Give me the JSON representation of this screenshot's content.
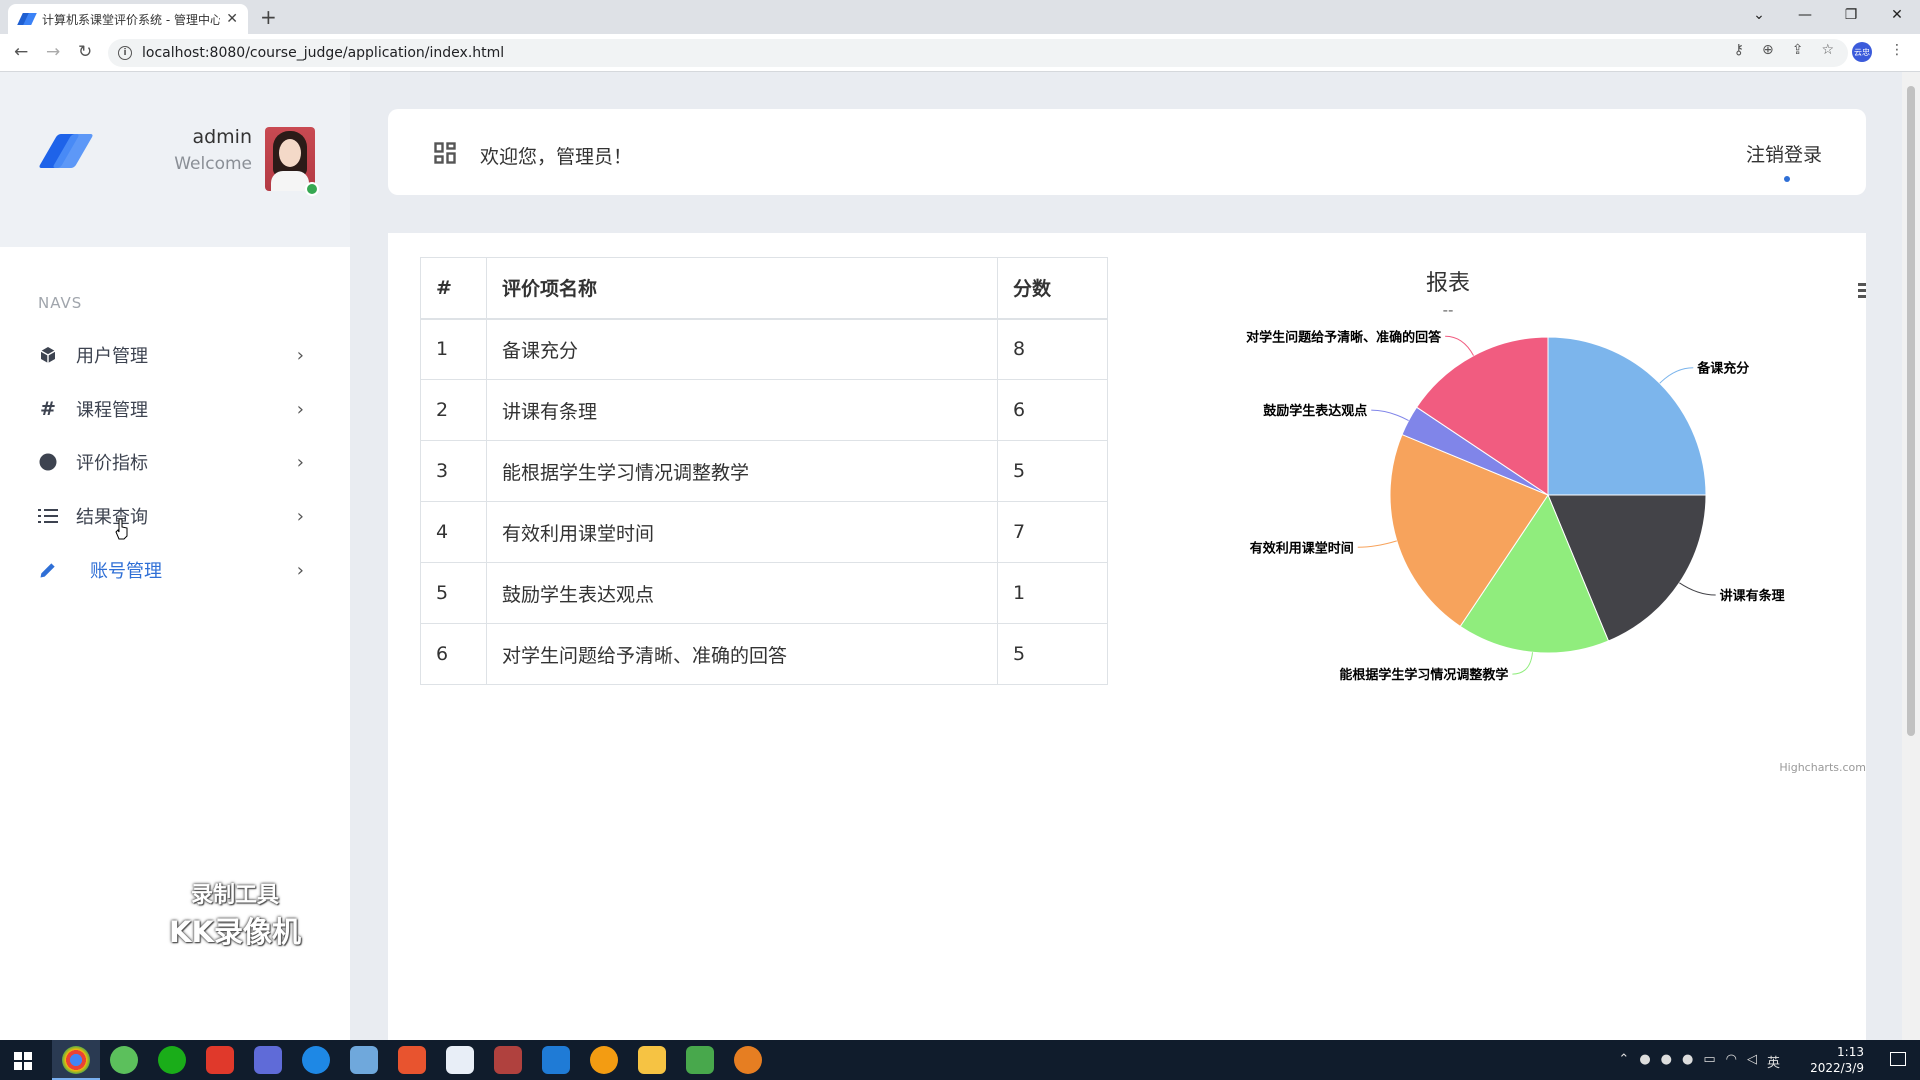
{
  "browser": {
    "tab_title": "计算机系课堂评价系统 - 管理中心",
    "tab_close": "✕",
    "new_tab": "+",
    "url": "localhost:8080/course_judge/application/index.html",
    "profile_label": "云忠"
  },
  "sidebar": {
    "user_name": "admin",
    "user_welcome": "Welcome",
    "navs_title": "NAVS",
    "items": [
      {
        "label": "用户管理",
        "icon": "cube-icon"
      },
      {
        "label": "课程管理",
        "icon": "hash-icon"
      },
      {
        "label": "评价指标",
        "icon": "circle-icon"
      },
      {
        "label": "结果查询",
        "icon": "list-icon"
      },
      {
        "label": "账号管理",
        "icon": "pencil-icon",
        "active": true
      }
    ],
    "watermark_line1": "录制工具",
    "watermark_line2": "KK录像机"
  },
  "header": {
    "welcome": "欢迎您，管理员！",
    "logout": "注销登录"
  },
  "table": {
    "headers": [
      "#",
      "评价项名称",
      "分数"
    ],
    "rows": [
      [
        "1",
        "备课充分",
        "8"
      ],
      [
        "2",
        "讲课有条理",
        "6"
      ],
      [
        "3",
        "能根据学生学习情况调整教学",
        "5"
      ],
      [
        "4",
        "有效利用课堂时间",
        "7"
      ],
      [
        "5",
        "鼓励学生表达观点",
        "1"
      ],
      [
        "6",
        "对学生问题给予清晰、准确的回答",
        "5"
      ]
    ]
  },
  "chart_data": {
    "type": "pie",
    "title": "报表",
    "subtitle": "--",
    "credits": "Highcharts.com",
    "slices": [
      {
        "name": "备课充分",
        "value": 8,
        "color": "#7cb5ec"
      },
      {
        "name": "讲课有条理",
        "value": 6,
        "color": "#434348"
      },
      {
        "name": "能根据学生学习情况调整教学",
        "value": 5,
        "color": "#90ed7d"
      },
      {
        "name": "有效利用课堂时间",
        "value": 7,
        "color": "#f7a35c"
      },
      {
        "name": "鼓励学生表达观点",
        "value": 1,
        "color": "#8085e9"
      },
      {
        "name": "对学生问题给予清晰、准确的回答",
        "value": 5,
        "color": "#f15c80"
      }
    ]
  },
  "taskbar": {
    "time": "1:13",
    "date": "2022/3/9",
    "ime": "英"
  }
}
